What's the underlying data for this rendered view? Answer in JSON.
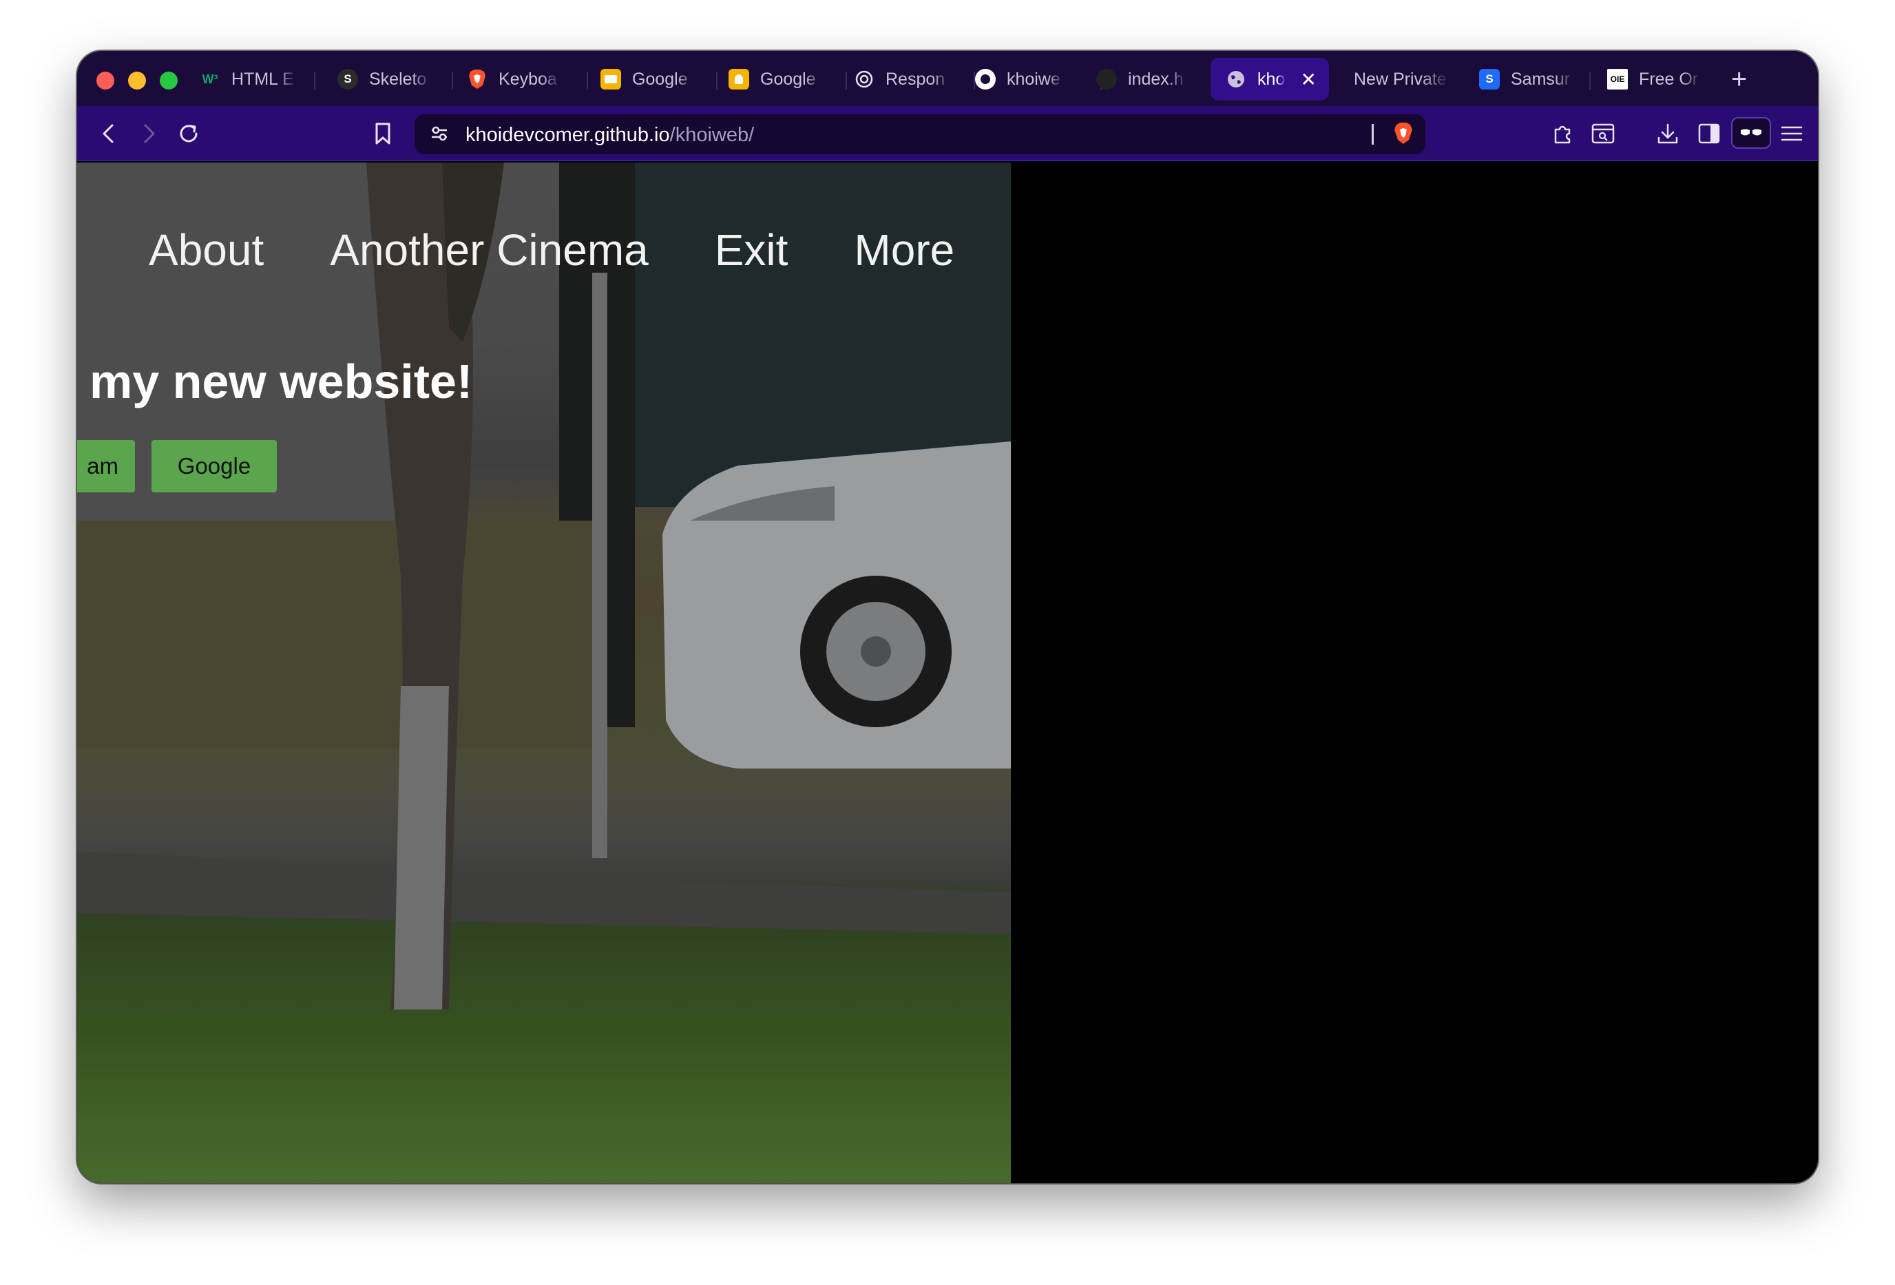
{
  "browser": {
    "tabs": [
      {
        "label": "HTML E",
        "favicon": "w3schools-icon",
        "fav_text": "W³",
        "fav_color": "#04aa6d"
      },
      {
        "label": "Skeleto",
        "favicon": "skeleton-icon",
        "fav_text": "S",
        "fav_color": "#222222"
      },
      {
        "label": "Keyboa",
        "favicon": "brave-icon",
        "fav_text": "",
        "fav_color": "#fb542b"
      },
      {
        "label": "Google",
        "favicon": "google-slides-icon",
        "fav_text": "",
        "fav_color": "#f4b400"
      },
      {
        "label": "Google",
        "favicon": "google-keep-icon",
        "fav_text": "",
        "fav_color": "#f4b400"
      },
      {
        "label": "Respon",
        "favicon": "openai-icon",
        "fav_text": "",
        "fav_color": "#ffffff"
      },
      {
        "label": "khoiwe",
        "favicon": "github-icon",
        "fav_text": "",
        "fav_color": "#ffffff"
      },
      {
        "label": "index.h",
        "favicon": "github-icon",
        "fav_text": "",
        "fav_color": "#222222"
      },
      {
        "label": "kho",
        "favicon": "globe-icon",
        "fav_text": "",
        "fav_color": "#c9c3d9",
        "active": true
      },
      {
        "label": "New Private",
        "favicon": "",
        "fav_text": "",
        "fav_color": ""
      },
      {
        "label": "Samsur",
        "favicon": "samsung-icon",
        "fav_text": "S",
        "fav_color": "#1f6bff"
      },
      {
        "label": "Free Or",
        "favicon": "oie-icon",
        "fav_text": "OIE",
        "fav_color": "#ffffff"
      }
    ],
    "new_tab_label": "+",
    "close_tab_label": "✕",
    "url": {
      "domain": "khoidevcomer.github.io",
      "path": "/khoiweb/"
    },
    "colors": {
      "tabstrip": "#1a0b3a",
      "toolbar": "#2a0b73",
      "active_tab": "#330e8c"
    }
  },
  "site": {
    "nav": [
      "About",
      "Another Cinema",
      "Exit",
      "More"
    ],
    "headline": "my new website!",
    "buttons": {
      "left_partial": "am",
      "google": "Google"
    },
    "button_color": "#5ba64d"
  }
}
